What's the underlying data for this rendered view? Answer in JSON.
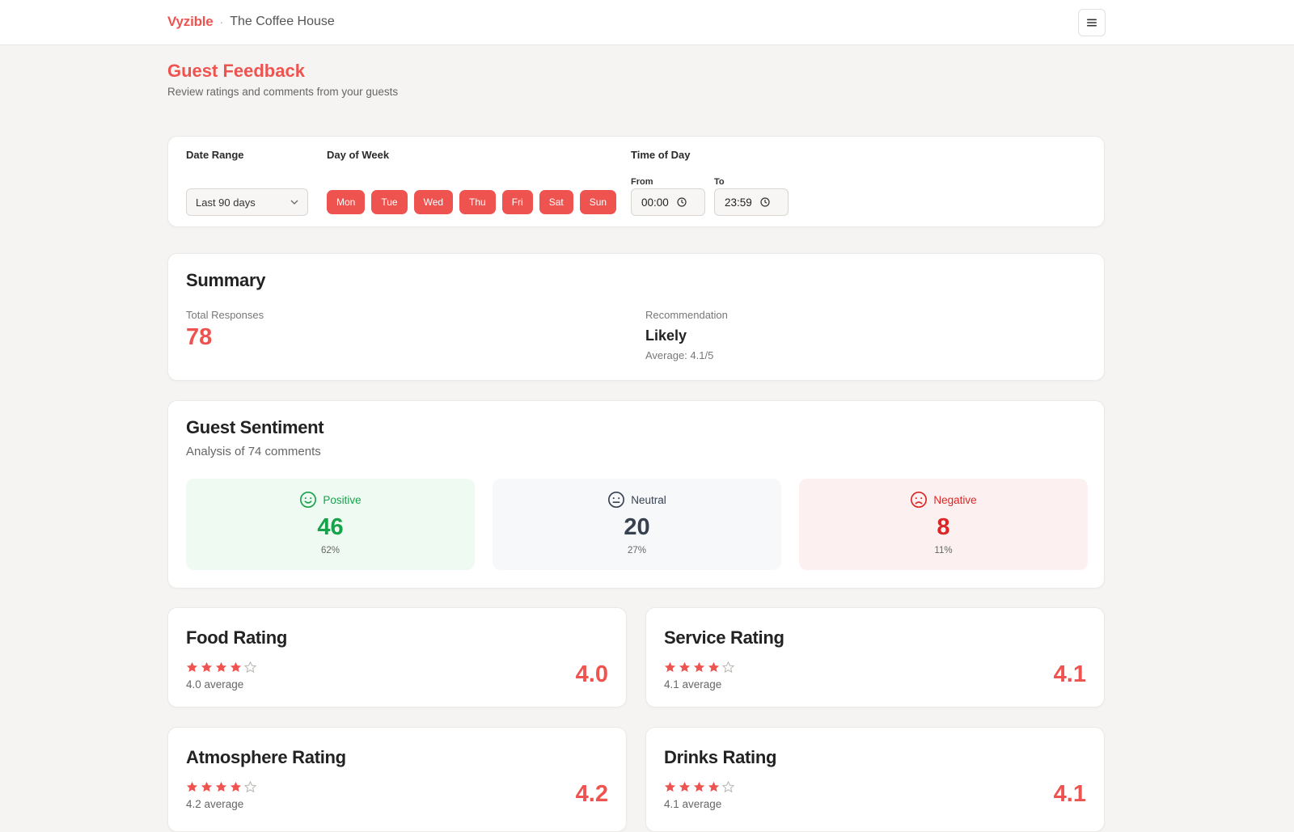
{
  "header": {
    "brand": "Vyzible",
    "separator": "·",
    "venue": "The Coffee House",
    "menu_icon": "hamburger-menu-icon"
  },
  "page": {
    "title": "Guest Feedback",
    "subtitle": "Review ratings and comments from your guests"
  },
  "filters": {
    "date_range_label": "Date Range",
    "date_range_value": "Last 90 days",
    "day_of_week_label": "Day of Week",
    "days": [
      "Mon",
      "Tue",
      "Wed",
      "Thu",
      "Fri",
      "Sat",
      "Sun"
    ],
    "time_of_day_label": "Time of Day",
    "from_label": "From",
    "from_value": "00:00",
    "to_label": "To",
    "to_value": "23:59"
  },
  "summary": {
    "title": "Summary",
    "total_label": "Total Responses",
    "total_value": "78",
    "recommendation_label": "Recommendation",
    "recommendation_value": "Likely",
    "average_text": "Average: 4.1/5"
  },
  "sentiment": {
    "title": "Guest Sentiment",
    "subtitle": "Analysis of 74 comments",
    "positive": {
      "label": "Positive",
      "count": "46",
      "pct": "62%",
      "color": "#16a34a",
      "bg": "#effaf2"
    },
    "neutral": {
      "label": "Neutral",
      "count": "20",
      "pct": "27%",
      "color": "#374151",
      "bg": "#f7f8fa"
    },
    "negative": {
      "label": "Negative",
      "count": "8",
      "pct": "11%",
      "color": "#dc2626",
      "bg": "#fdf0f0"
    }
  },
  "ratings": [
    {
      "title": "Food Rating",
      "value": "4.0",
      "sub": "4.0 average",
      "stars": 4
    },
    {
      "title": "Service Rating",
      "value": "4.1",
      "sub": "4.1 average",
      "stars": 4
    },
    {
      "title": "Atmosphere Rating",
      "value": "4.2",
      "sub": "4.2 average",
      "stars": 4
    },
    {
      "title": "Drinks Rating",
      "value": "4.1",
      "sub": "4.1 average",
      "stars": 4
    }
  ],
  "colors": {
    "accent": "#ef5350",
    "star_empty": "#b9b6b2"
  }
}
